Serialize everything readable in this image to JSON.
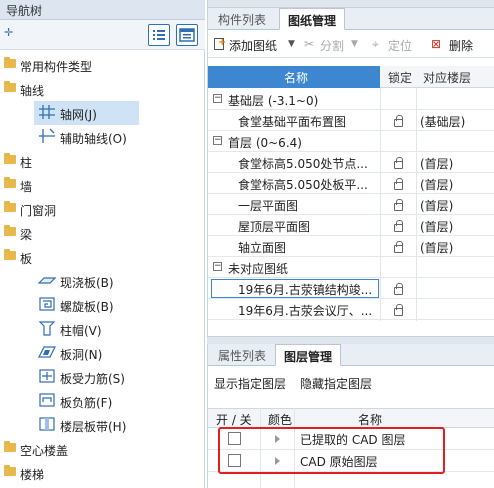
{
  "nav": {
    "title": "导航树",
    "tree": [
      {
        "label": "常用构件类型",
        "level": 0
      },
      {
        "label": "轴线",
        "level": 0
      },
      {
        "label": "轴网(J)",
        "level": 1,
        "selected": true
      },
      {
        "label": "辅助轴线(O)",
        "level": 1
      },
      {
        "label": "柱",
        "level": 0
      },
      {
        "label": "墙",
        "level": 0
      },
      {
        "label": "门窗洞",
        "level": 0
      },
      {
        "label": "梁",
        "level": 0
      },
      {
        "label": "板",
        "level": 0
      },
      {
        "label": "现浇板(B)",
        "level": 1
      },
      {
        "label": "螺旋板(B)",
        "level": 1
      },
      {
        "label": "柱帽(V)",
        "level": 1
      },
      {
        "label": "板洞(N)",
        "level": 1
      },
      {
        "label": "板受力筋(S)",
        "level": 1
      },
      {
        "label": "板负筋(F)",
        "level": 1
      },
      {
        "label": "楼层板带(H)",
        "level": 1
      },
      {
        "label": "空心楼盖",
        "level": 0
      },
      {
        "label": "楼梯",
        "level": 0
      }
    ]
  },
  "drawing_panel": {
    "tabs": [
      "构件列表",
      "图纸管理"
    ],
    "active_tab": "图纸管理",
    "toolbar": {
      "add": "添加图纸",
      "split": "分割",
      "locate": "定位",
      "delete": "删除"
    },
    "columns": {
      "name": "名称",
      "lock": "锁定",
      "floor": "对应楼层"
    },
    "groups": [
      {
        "label": "基础层 (-3.1~0)",
        "rows": [
          {
            "name": "食堂基础平面布置图",
            "floor": "(基础层)"
          }
        ]
      },
      {
        "label": "首层 (0~6.4)",
        "rows": [
          {
            "name": "食堂标高5.050处节点...",
            "floor": "(首层)"
          },
          {
            "name": "食堂标高5.050处板平...",
            "floor": "(首层)"
          },
          {
            "name": "一层平面图",
            "floor": "(首层)"
          },
          {
            "name": "屋顶层平面图",
            "floor": "(首层)"
          },
          {
            "name": "轴立面图",
            "floor": "(首层)"
          }
        ]
      },
      {
        "label": "未对应图纸",
        "rows": [
          {
            "name": "19年6月.古荥镇结构竣...",
            "floor": ""
          },
          {
            "name": "19年6月.古荥会议厅、...",
            "floor": ""
          }
        ]
      }
    ]
  },
  "layer_panel": {
    "tabs": [
      "属性列表",
      "图层管理"
    ],
    "active_tab": "图层管理",
    "actions": {
      "show": "显示指定图层",
      "hide": "隐藏指定图层"
    },
    "columns": {
      "toggle": "开 / 关",
      "color": "颜色",
      "name": "名称"
    },
    "rows": [
      {
        "name": "已提取的 CAD 图层"
      },
      {
        "name": "CAD 原始图层"
      }
    ],
    "highlight_color": "#e02020"
  }
}
